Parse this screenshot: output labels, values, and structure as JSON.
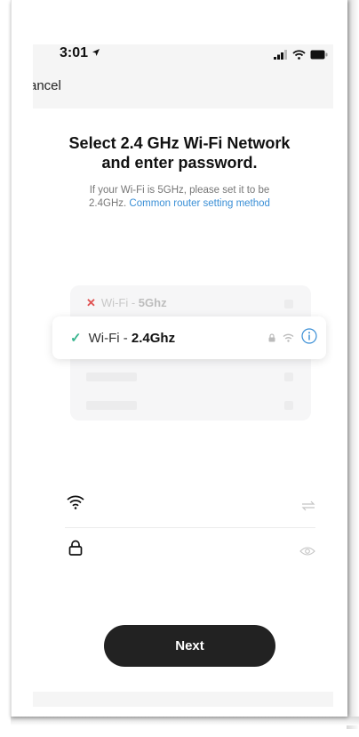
{
  "status_bar": {
    "time": "3:01",
    "icons": [
      "location-arrow-icon",
      "signal-icon",
      "wifi-icon",
      "battery-icon"
    ]
  },
  "nav": {
    "cancel_label": "ancel"
  },
  "header": {
    "title_line1": "Select 2.4 GHz Wi-Fi Network",
    "title_line2": "and enter password.",
    "subtitle_line1": "If your Wi-Fi is 5GHz, please set it to be",
    "subtitle_line2_prefix": "2.4GHz.",
    "subtitle_link": "Common router setting method"
  },
  "networks": {
    "wrong": {
      "prefix": "Wi-Fi - ",
      "band": "5Ghz",
      "mark_icon": "x-mark-icon"
    },
    "right": {
      "prefix": "Wi-Fi - ",
      "band": "2.4Ghz",
      "mark_icon": "checkmark-icon",
      "icons": [
        "lock-icon",
        "wifi-icon",
        "info-icon"
      ]
    }
  },
  "form": {
    "wifi_field": {
      "icon": "wifi-icon",
      "action_icon": "switch-arrows-icon",
      "value": ""
    },
    "password_field": {
      "icon": "lock-icon",
      "action_icon": "eye-icon",
      "value": ""
    }
  },
  "footer": {
    "next_label": "Next"
  },
  "colors": {
    "accent_link": "#3a8fd6",
    "check": "#3ab58f",
    "error": "#e05252",
    "button_bg": "#222222"
  }
}
